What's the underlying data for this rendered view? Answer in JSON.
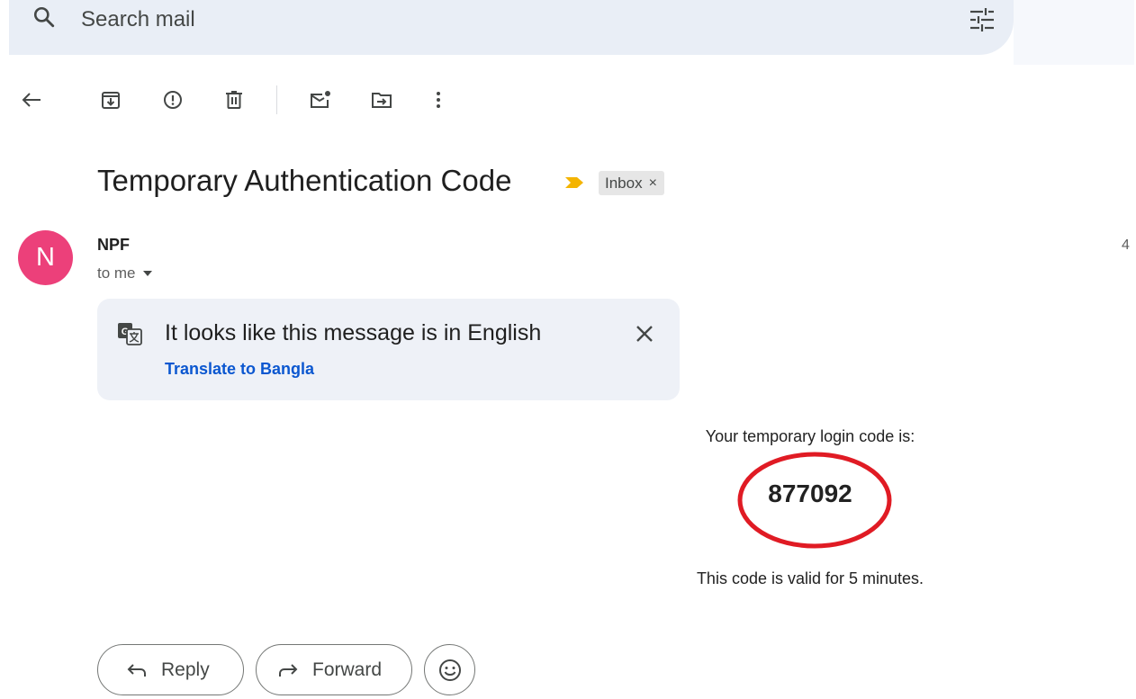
{
  "search": {
    "placeholder": "Search mail"
  },
  "toolbar": {
    "icons": [
      "back-arrow-icon",
      "archive-icon",
      "report-spam-icon",
      "delete-icon",
      "mark-unread-icon",
      "move-to-icon",
      "more-vert-icon"
    ]
  },
  "email": {
    "subject": "Temporary Authentication Code",
    "label": "Inbox",
    "label_remove": "×",
    "sender": {
      "initial": "N",
      "name": "NPF",
      "recipient": "to me",
      "avatar_color": "#ec407a"
    },
    "date": "4",
    "translate": {
      "message": "It looks like this message is in English",
      "link": "Translate to Bangla"
    },
    "body": {
      "line1": "Your temporary login code is:",
      "code": "877092",
      "line2": "This code is valid for 5 minutes."
    }
  },
  "actions": {
    "reply": "Reply",
    "forward": "Forward"
  },
  "colors": {
    "search_bg": "#e9eef6",
    "link": "#0b57d0",
    "importance": "#f4b400",
    "ring": "#e01b24"
  }
}
